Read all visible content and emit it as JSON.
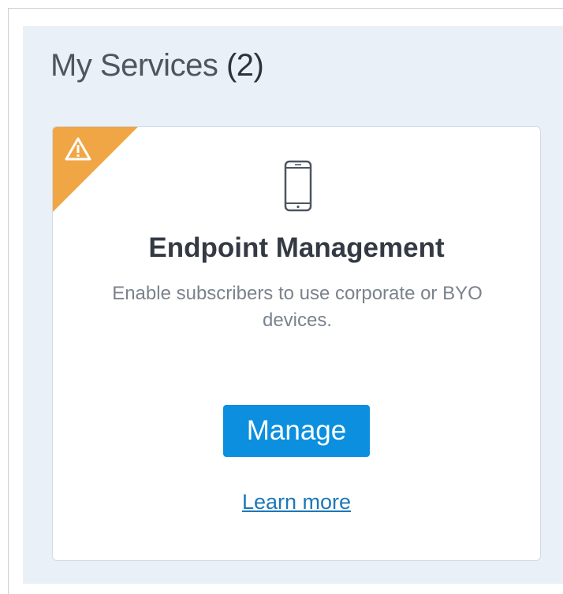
{
  "panel": {
    "title": "My Services",
    "count": "(2)"
  },
  "card": {
    "status_icon": "warning-icon",
    "service_icon": "smartphone-icon",
    "title": "Endpoint Management",
    "description": "Enable subscribers to use corporate or BYO devices.",
    "button_label": "Manage",
    "link_label": "Learn more",
    "colors": {
      "warning_ribbon": "#f0a645",
      "button": "#0b8fde",
      "link": "#1c78b8",
      "panel_background": "#eaf0f7"
    }
  }
}
